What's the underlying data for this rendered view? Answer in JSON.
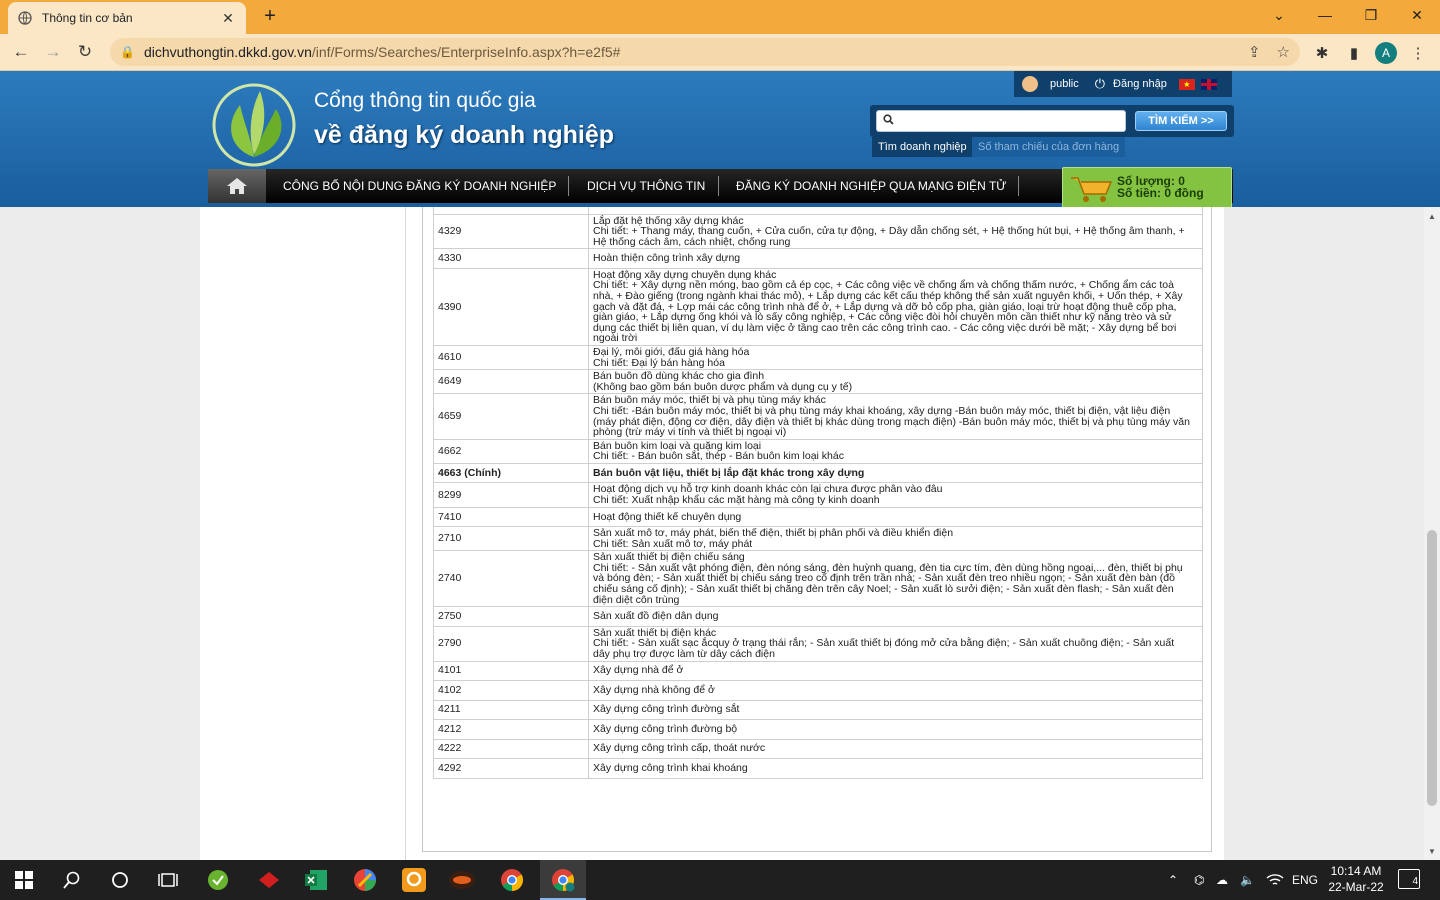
{
  "browser": {
    "tab_title": "Thông tin cơ bản",
    "url_host": "dichvuthongtin.dkkd.gov.vn",
    "url_path": "/inf/Forms/Searches/EnterpriseInfo.aspx?h=e2f5#",
    "profile_initial": "A"
  },
  "header": {
    "title_line1": "Cổng thông tin quốc gia",
    "title_line2": "về đăng ký doanh nghiệp",
    "user_name": "public",
    "login_label": "Đăng nhập",
    "flag_vn_star": "★",
    "search_button": "TÌM KIẾM >>",
    "search_tab_active": "Tìm doanh nghiệp",
    "search_tab_inactive": "Số tham chiếu của đơn hàng"
  },
  "nav": {
    "items": [
      "CÔNG BỐ NỘI DUNG ĐĂNG KÝ DOANH NGHIỆP",
      "DỊCH VỤ THÔNG TIN",
      "ĐĂNG KÝ DOANH NGHIỆP QUA MẠNG ĐIỆN TỬ"
    ]
  },
  "cart": {
    "quantity": "Số lượng: 0",
    "amount": "Số tiền: 0 đồng"
  },
  "business_lines": [
    {
      "code": "4329",
      "lines": [
        "Lắp đặt hệ thống xây dựng khác",
        "Chi tiết: + Thang máy, thang cuốn, + Cửa cuốn, cửa tự động, + Dây dẫn chống sét, + Hệ thống hút bụi, + Hệ thống âm thanh, +",
        "Hệ thống cách âm, cách nhiệt, chống rung"
      ]
    },
    {
      "code": "4330",
      "lines": [
        "Hoàn thiện công trình xây dựng"
      ]
    },
    {
      "code": "4390",
      "lines": [
        "Hoạt động xây dựng chuyên dụng khác",
        "Chi tiết: + Xây dựng nền móng, bao gồm cả ép cọc, + Các công việc về chống ẩm và chống thấm nước, + Chống ẩm các toà",
        "nhà, + Đào giếng (trong ngành khai thác mỏ), + Lắp dựng các kết cấu thép không thể sản xuất nguyên khối, + Uốn thép, + Xây",
        "gạch và đặt đá, + Lợp mái các công trình nhà để ở, + Lắp dựng và dỡ bỏ cốp pha, giàn giáo, loại trừ hoạt động thuê cốp pha,",
        "giàn giáo, + Lắp dựng ống khói và lò sấy công nghiệp, + Các công việc đòi hỏi chuyên môn cần thiết như kỹ năng trèo và sử",
        "dụng các thiết bị liên quan, ví dụ làm việc ở tầng cao trên các công trình cao. - Các công việc dưới bề mặt; - Xây dựng bể bơi",
        "ngoài trời"
      ]
    },
    {
      "code": "4610",
      "lines": [
        "Đại lý, môi giới, đấu giá hàng hóa",
        "Chi tiết: Đại lý bán hàng hóa"
      ]
    },
    {
      "code": "4649",
      "lines": [
        "Bán buôn đồ dùng khác cho gia đình",
        "(Không bao gồm bán buôn dược phẩm và dụng cụ y tế)"
      ]
    },
    {
      "code": "4659",
      "lines": [
        "Bán buôn máy móc, thiết bị và phụ tùng máy khác",
        "Chi tiết: -Bán buôn máy móc, thiết bị và phụ tùng máy khai khoáng, xây dựng -Bán buôn máy móc, thiết bị điện, vật liệu điện",
        "(máy phát điện, động cơ điện, dây điện và thiết bị khác dùng trong mạch điện) -Bán buôn máy móc, thiết bị và phụ tùng máy văn",
        "phòng (trừ máy vi tính và thiết bị ngoại vi)"
      ]
    },
    {
      "code": "4662",
      "lines": [
        "Bán buôn kim loại và quặng kim loại",
        "Chi tiết: - Bán buôn sắt, thép - Bán buôn kim loại khác"
      ]
    },
    {
      "code": "4663 (Chính)",
      "main": true,
      "lines": [
        "Bán buôn vật liệu, thiết bị lắp đặt khác trong xây dựng"
      ]
    },
    {
      "code": "8299",
      "lines": [
        "Hoạt động dịch vụ hỗ trợ kinh doanh khác còn lại chưa được phân vào đâu",
        "Chi tiết: Xuất nhập khẩu các mặt hàng mà công ty kinh doanh"
      ]
    },
    {
      "code": "7410",
      "lines": [
        "Hoạt động thiết kế chuyên dụng"
      ]
    },
    {
      "code": "2710",
      "lines": [
        "Sản xuất mô tơ, máy phát, biến thế điện, thiết bị phân phối và điều khiển điện",
        "Chi tiết: Sản xuất mô tơ, máy phát"
      ]
    },
    {
      "code": "2740",
      "lines": [
        "Sản xuất thiết bị điện chiếu sáng",
        "Chi tiết: - Sản xuất vật phóng điện, đèn nóng sáng, đèn huỳnh quang, đèn tia cực tím, đèn dùng hồng ngoại,... đèn, thiết bị phụ",
        "và bóng đèn; - Sản xuất thiết bị chiếu sáng treo cố định trên trần nhà; - Sản xuất đèn treo nhiều ngọn; - Sản xuất đèn bàn (đồ",
        "chiếu sáng cố định); - Sản xuất thiết bị chăng đèn trên cây Noel; - Sản xuất lò sưởi điện; - Sản xuất đèn flash; - Sản xuất đèn",
        "điện diệt côn trùng"
      ]
    },
    {
      "code": "2750",
      "lines": [
        "Sản xuất đồ điện dân dụng"
      ]
    },
    {
      "code": "2790",
      "lines": [
        "Sản xuất thiết bị điện khác",
        "Chi tiết: - Sản xuất sạc ắcquy ở trạng thái rắn; - Sản xuất thiết bị đóng mở cửa bằng điện; - Sản xuất chuông điện; - Sản xuất",
        "dây phụ trợ được làm từ dây cách điện"
      ]
    },
    {
      "code": "4101",
      "lines": [
        "Xây dựng nhà để ở"
      ]
    },
    {
      "code": "4102",
      "lines": [
        "Xây dựng nhà không để ở"
      ]
    },
    {
      "code": "4211",
      "lines": [
        "Xây dựng công trình đường sắt"
      ]
    },
    {
      "code": "4212",
      "lines": [
        "Xây dựng công trình đường bộ"
      ]
    },
    {
      "code": "4222",
      "lines": [
        "Xây dựng công trình cấp, thoát nước"
      ]
    },
    {
      "code": "4292",
      "lines": [
        "Xây dựng công trình khai khoáng"
      ]
    }
  ],
  "taskbar": {
    "language": "ENG",
    "time": "10:14 AM",
    "date": "22-Mar-22",
    "notification_count": "4"
  }
}
